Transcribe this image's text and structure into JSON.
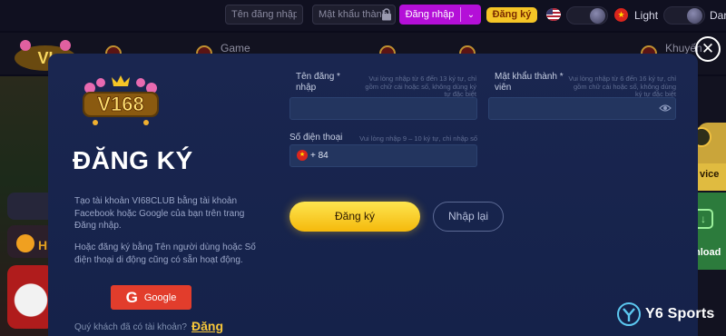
{
  "topbar": {
    "username_placeholder": "Tên đăng nhập/số",
    "password_placeholder": "Mật khẩu thành",
    "login_label": "Đăng nhập",
    "register_label": "Đăng ký",
    "light_label": "Light",
    "dark_label": "Dar"
  },
  "nav": {
    "items": [
      "Game",
      "Khuyến"
    ]
  },
  "side": {
    "left_label": "H",
    "service_label": "vice",
    "download_label": "nload"
  },
  "modal": {
    "logo_text": "V168",
    "title": "ĐĂNG KÝ",
    "desc1": "Tạo tài khoản VI68CLUB bằng tài khoản Facebook hoặc Google của bạn trên trang Đăng nhập.",
    "desc2": "Hoặc đăng ký bằng Tên người dùng hoặc Số điện thoại di động cũng có sẵn hoạt động.",
    "google_label": "Google",
    "have_account": "Quý khách đã có tài khoản?",
    "login_link": "Đăng",
    "form": {
      "username_label": "Tên đăng * nhập",
      "username_hint": "Vui lòng nhập từ 6 đến 13 ký tự, chỉ gồm chữ cái hoặc số, không dùng ký tự đặc biệt",
      "password_label": "Mật khẩu thành * viên",
      "password_hint": "Vui lòng nhập từ 6 đến 16 ký tự, chỉ gồm chữ cái hoặc số, không dùng ký tự đặc biệt",
      "phone_label": "Số điện thoại",
      "phone_hint": "Vui lòng nhập 9 – 10 ký tự, chỉ nhập số",
      "phone_prefix": "+ 84",
      "submit_label": "Đăng ký",
      "relogin_label": "Nhập lại"
    }
  },
  "watermark": {
    "text": "Y6 Sports"
  },
  "colors": {
    "modal_bg": "#1a2650",
    "input_bg": "#23355f",
    "accent_yellow": "#f5c526",
    "login_purple": "#b40fd8",
    "google_red": "#e23d2c"
  }
}
